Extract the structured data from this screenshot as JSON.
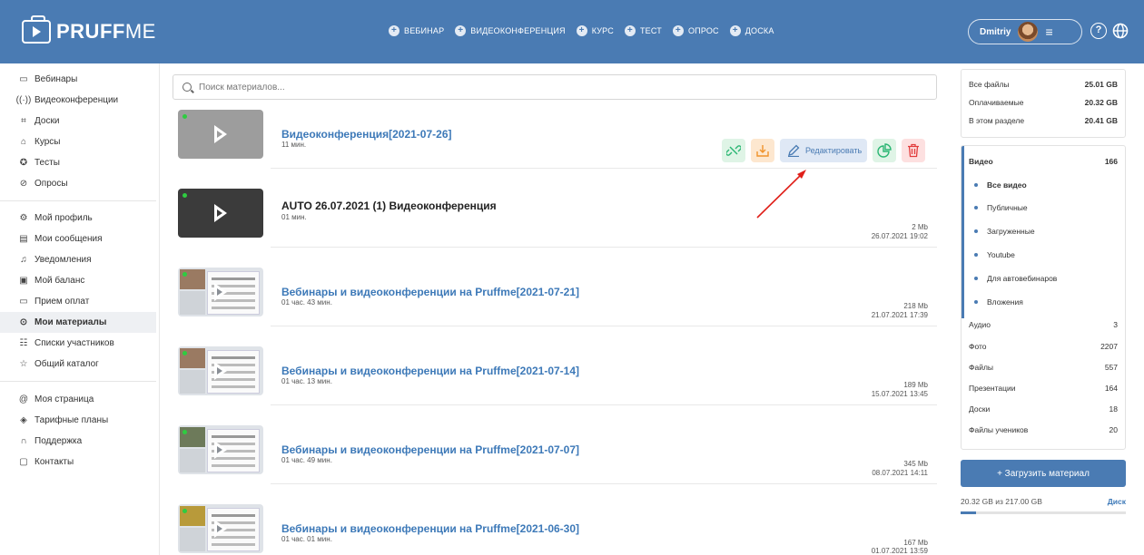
{
  "brand": {
    "logo_bold": "PRUFF",
    "logo_light": "ME"
  },
  "create_menu": [
    {
      "label": "ВЕБИНАР"
    },
    {
      "label": "ВИДЕОКОНФЕРЕНЦИЯ"
    },
    {
      "label": "КУРС"
    },
    {
      "label": "ТЕСТ"
    },
    {
      "label": "ОПРОС"
    },
    {
      "label": "ДОСКА"
    }
  ],
  "user": {
    "name": "Dmitriy"
  },
  "sidebar": {
    "group1": [
      {
        "label": "Вебинары",
        "icon": "webinar-icon"
      },
      {
        "label": "Видеоконференции",
        "icon": "broadcast-icon"
      },
      {
        "label": "Доски",
        "icon": "board-icon"
      },
      {
        "label": "Курсы",
        "icon": "courses-icon"
      },
      {
        "label": "Тесты",
        "icon": "award-icon"
      },
      {
        "label": "Опросы",
        "icon": "check-circle-icon"
      }
    ],
    "group2": [
      {
        "label": "Мой профиль",
        "icon": "profile-icon"
      },
      {
        "label": "Мои сообщения",
        "icon": "message-icon"
      },
      {
        "label": "Уведомления",
        "icon": "bell-icon"
      },
      {
        "label": "Мой баланс",
        "icon": "wallet-icon"
      },
      {
        "label": "Прием оплат",
        "icon": "card-icon"
      },
      {
        "label": "Мои материалы",
        "icon": "play-circle-icon",
        "active": true
      },
      {
        "label": "Списки участников",
        "icon": "users-icon"
      },
      {
        "label": "Общий каталог",
        "icon": "star-icon"
      }
    ],
    "group3": [
      {
        "label": "Моя страница",
        "icon": "at-icon"
      },
      {
        "label": "Тарифные планы",
        "icon": "diamond-icon"
      },
      {
        "label": "Поддержка",
        "icon": "headset-icon"
      },
      {
        "label": "Контакты",
        "icon": "contacts-icon"
      }
    ]
  },
  "search": {
    "placeholder": "Поиск материалов..."
  },
  "materials": [
    {
      "title": "Видеоконференция[2021-07-26]",
      "duration": "11 мин.",
      "size": "",
      "date": "",
      "thumb": "grey"
    },
    {
      "title": "AUTO 26.07.2021 (1) Видеоконференция",
      "duration": "01 мин.",
      "size": "2 Mb",
      "date": "26.07.2021 19:02",
      "thumb": "dark"
    },
    {
      "title": "Вебинары и видеоконференции на Pruffme[2021-07-21]",
      "duration": "01 час. 43 мин.",
      "size": "218 Mb",
      "date": "21.07.2021 17:39",
      "thumb": "screen"
    },
    {
      "title": "Вебинары и видеоконференции на Pruffme[2021-07-14]",
      "duration": "01 час. 13 мин.",
      "size": "189 Mb",
      "date": "15.07.2021 13:45",
      "thumb": "screen"
    },
    {
      "title": "Вебинары и видеоконференции на Pruffme[2021-07-07]",
      "duration": "01 час. 49 мин.",
      "size": "345 Mb",
      "date": "08.07.2021 14:11",
      "thumb": "screen"
    },
    {
      "title": "Вебинары и видеоконференции на Pruffme[2021-06-30]",
      "duration": "01 час. 01 мин.",
      "size": "167 Mb",
      "date": "01.07.2021 13:59",
      "thumb": "screen"
    }
  ],
  "actions": {
    "edit_label": "Редактировать"
  },
  "storage": {
    "rows": [
      {
        "label": "Все файлы",
        "value": "25.01 GB"
      },
      {
        "label": "Оплачиваемые",
        "value": "20.32 GB"
      },
      {
        "label": "В этом разделе",
        "value": "20.41 GB"
      }
    ]
  },
  "categories": {
    "video": {
      "label": "Видео",
      "count": "166"
    },
    "video_sub": [
      {
        "label": "Все видео",
        "selected": true
      },
      {
        "label": "Публичные"
      },
      {
        "label": "Загруженные"
      },
      {
        "label": "Youtube"
      },
      {
        "label": "Для автовебинаров"
      },
      {
        "label": "Вложения"
      }
    ],
    "others": [
      {
        "label": "Аудио",
        "count": "3"
      },
      {
        "label": "Фото",
        "count": "2207"
      },
      {
        "label": "Файлы",
        "count": "557"
      },
      {
        "label": "Презентации",
        "count": "164"
      },
      {
        "label": "Доски",
        "count": "18"
      },
      {
        "label": "Файлы учеников",
        "count": "20"
      }
    ]
  },
  "upload": {
    "label": "+ Загрузить материал"
  },
  "disk": {
    "usage": "20.32 GB из 217.00 GB",
    "link": "Диск",
    "fill_fraction": 0.094
  },
  "colors": {
    "brand": "#4a7bb3",
    "link": "#3d79b8",
    "online_dot": "#2ecc40"
  }
}
